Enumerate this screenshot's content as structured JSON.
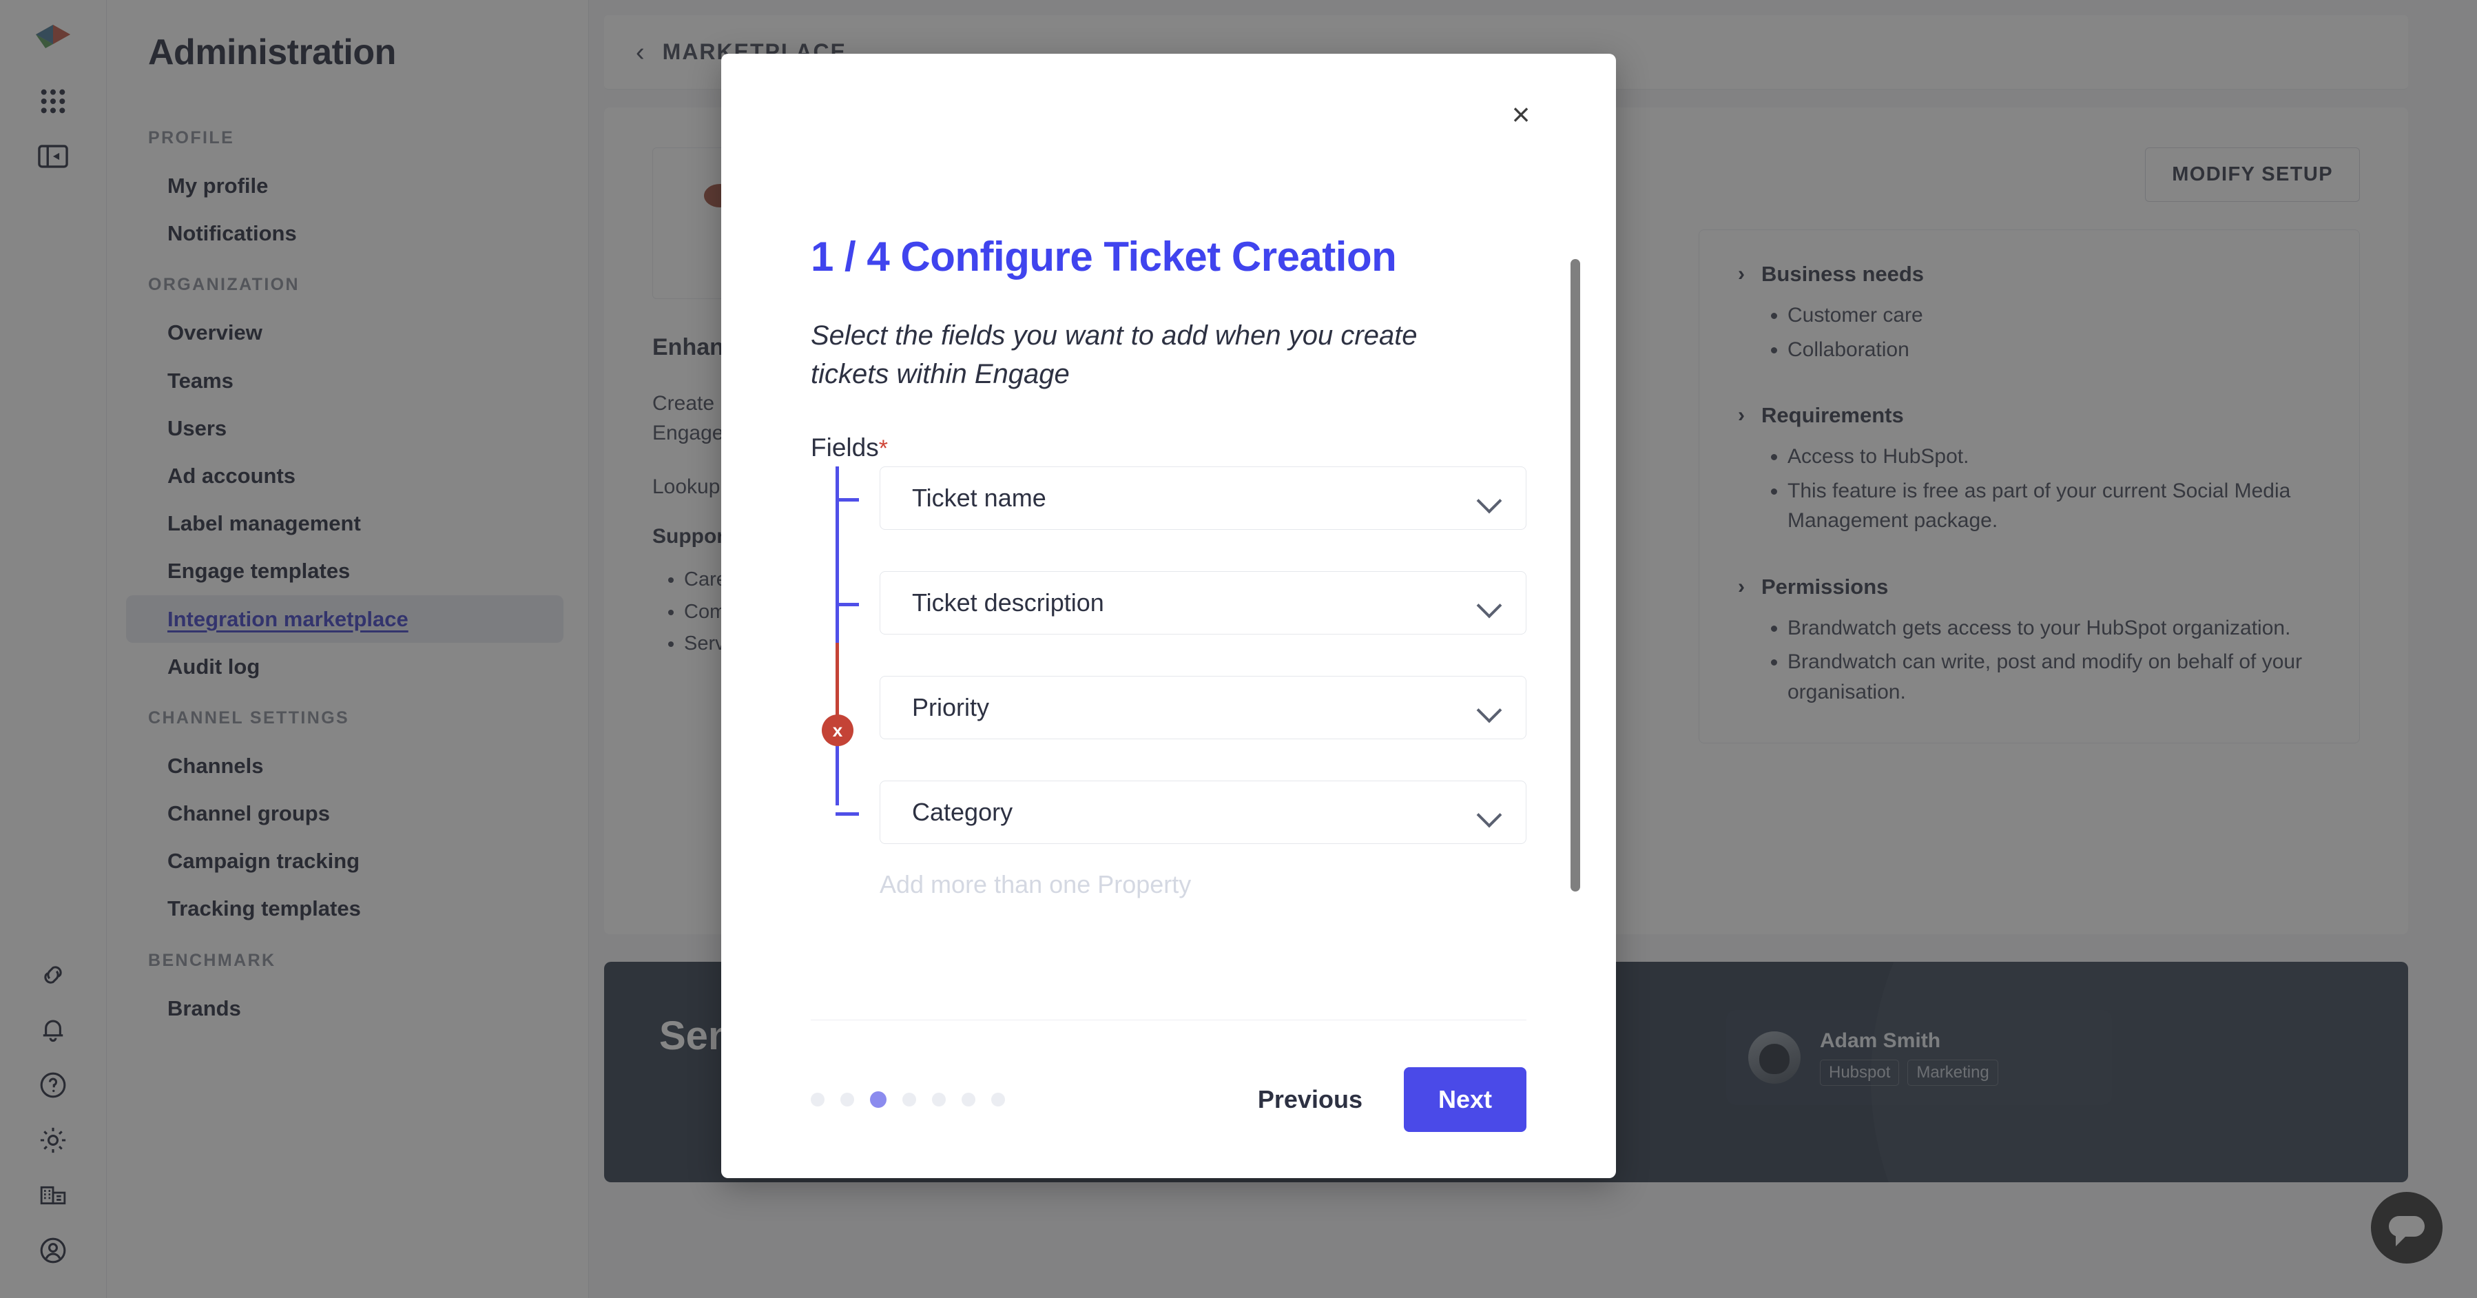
{
  "rail": {
    "icons": [
      {
        "name": "logo",
        "label": "Brandwatch logo"
      },
      {
        "name": "grid-icon",
        "label": "Apps"
      },
      {
        "name": "panel-toggle-icon",
        "label": "Toggle panel"
      },
      {
        "name": "link-icon",
        "label": "Links"
      },
      {
        "name": "bell-icon",
        "label": "Notifications"
      },
      {
        "name": "help-icon",
        "label": "Help"
      },
      {
        "name": "gear-icon",
        "label": "Settings"
      },
      {
        "name": "building-icon",
        "label": "Organization"
      },
      {
        "name": "account-icon",
        "label": "Account"
      }
    ]
  },
  "sidebar": {
    "title": "Administration",
    "groups": [
      {
        "label": "PROFILE",
        "items": [
          {
            "label": "My profile",
            "active": false
          },
          {
            "label": "Notifications",
            "active": false
          }
        ]
      },
      {
        "label": "ORGANIZATION",
        "items": [
          {
            "label": "Overview",
            "active": false
          },
          {
            "label": "Teams",
            "active": false
          },
          {
            "label": "Users",
            "active": false
          },
          {
            "label": "Ad accounts",
            "active": false
          },
          {
            "label": "Label management",
            "active": false
          },
          {
            "label": "Engage templates",
            "active": false
          },
          {
            "label": "Integration marketplace",
            "active": true
          },
          {
            "label": "Audit log",
            "active": false
          }
        ]
      },
      {
        "label": "CHANNEL SETTINGS",
        "items": [
          {
            "label": "Channels",
            "active": false
          },
          {
            "label": "Channel groups",
            "active": false
          },
          {
            "label": "Campaign tracking",
            "active": false
          },
          {
            "label": "Tracking templates",
            "active": false
          }
        ]
      },
      {
        "label": "BENCHMARK",
        "items": [
          {
            "label": "Brands",
            "active": false
          }
        ]
      }
    ]
  },
  "breadcrumb": {
    "back_arrow": "‹",
    "text": "MARKETPLACE"
  },
  "detail": {
    "modify_setup_label": "MODIFY SETUP",
    "heading": "Enhance your customer care with HubSpot",
    "paragraph_1": "Create HubSpot tickets from public and private messages within Engage.",
    "paragraph_2": "Lookup HubSpot contacts in Engage.",
    "support_heading": "Supported channels",
    "support_items": [
      "Care",
      "Community",
      "Service"
    ],
    "accordions": [
      {
        "title": "Business needs",
        "items": [
          "Customer care",
          "Collaboration"
        ]
      },
      {
        "title": "Requirements",
        "items": [
          "Access to HubSpot.",
          "This feature is free as part of your current Social Media Management package."
        ]
      },
      {
        "title": "Permissions",
        "items": [
          "Brandwatch gets access to your HubSpot organization.",
          "Brandwatch can write, post and modify on behalf of your organisation."
        ]
      }
    ]
  },
  "promo": {
    "heading": "Send tickets",
    "person": {
      "name": "Adam Smith",
      "tags": [
        "Hubspot",
        "Marketing"
      ]
    }
  },
  "chat": {
    "icon": "chat-bubble-icon"
  },
  "modal": {
    "close_label": "×",
    "title": "1 / 4 Configure Ticket Creation",
    "subtitle": "Select the fields you want to add when you create tickets within Engage",
    "fields_label": "Fields",
    "required_mark": "*",
    "badge_label": "x",
    "fields": [
      {
        "label": "Ticket name",
        "chevron": "chevron-down-icon"
      },
      {
        "label": "Ticket description",
        "chevron": "chevron-down-icon"
      },
      {
        "label": "Priority",
        "chevron": "chevron-down-icon"
      },
      {
        "label": "Category",
        "chevron": "chevron-down-icon"
      }
    ],
    "add_more_hint": "Add more than one Property",
    "pagination": {
      "total": 7,
      "active_index": 2
    },
    "previous_label": "Previous",
    "next_label": "Next"
  },
  "colors": {
    "accent": "#4a4ae8",
    "title": "#4044ee",
    "error": "#c44336",
    "timeline": "#4f4fe8",
    "dot_active": "#8b8bee",
    "dot_inactive": "#ebedf2"
  }
}
